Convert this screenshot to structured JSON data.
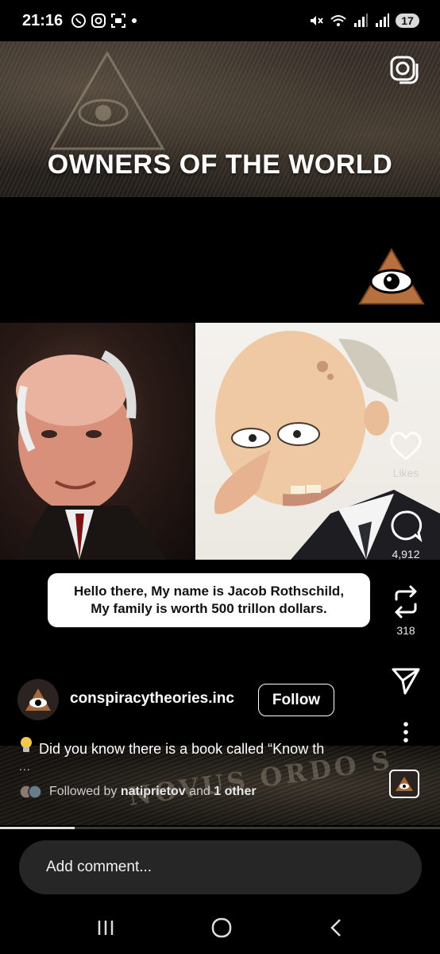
{
  "status_bar": {
    "time": "21:16",
    "battery": "17"
  },
  "banner": {
    "title": "OWNERS OF THE WORLD"
  },
  "post": {
    "caption_line1": "Hello there, My name is Jacob Rothschild,",
    "caption_line2": "My family is worth 500 trillon dollars.",
    "likes_label": "Likes",
    "comments_count": "4,912",
    "reposts_count": "318"
  },
  "account": {
    "username": "conspiracytheories.inc",
    "follow_label": "Follow",
    "description": "Did you know there is a book called “Know th",
    "more": "...",
    "followed_prefix": "Followed by",
    "followed_user": "natiprietov",
    "followed_and": "and",
    "followed_other": "1 other"
  },
  "bottom_text": "NOVUS ORDO S",
  "progress": 0.17,
  "comment": {
    "placeholder": "Add comment..."
  },
  "icons": {
    "camera": "camera-icon",
    "heart": "heart-icon",
    "comment": "comment-icon",
    "repost": "repost-icon",
    "share": "send-icon",
    "more": "more-vertical-icon"
  },
  "colors": {
    "background": "#000000",
    "bubble": "#ffffff",
    "comment_box": "#262626"
  }
}
